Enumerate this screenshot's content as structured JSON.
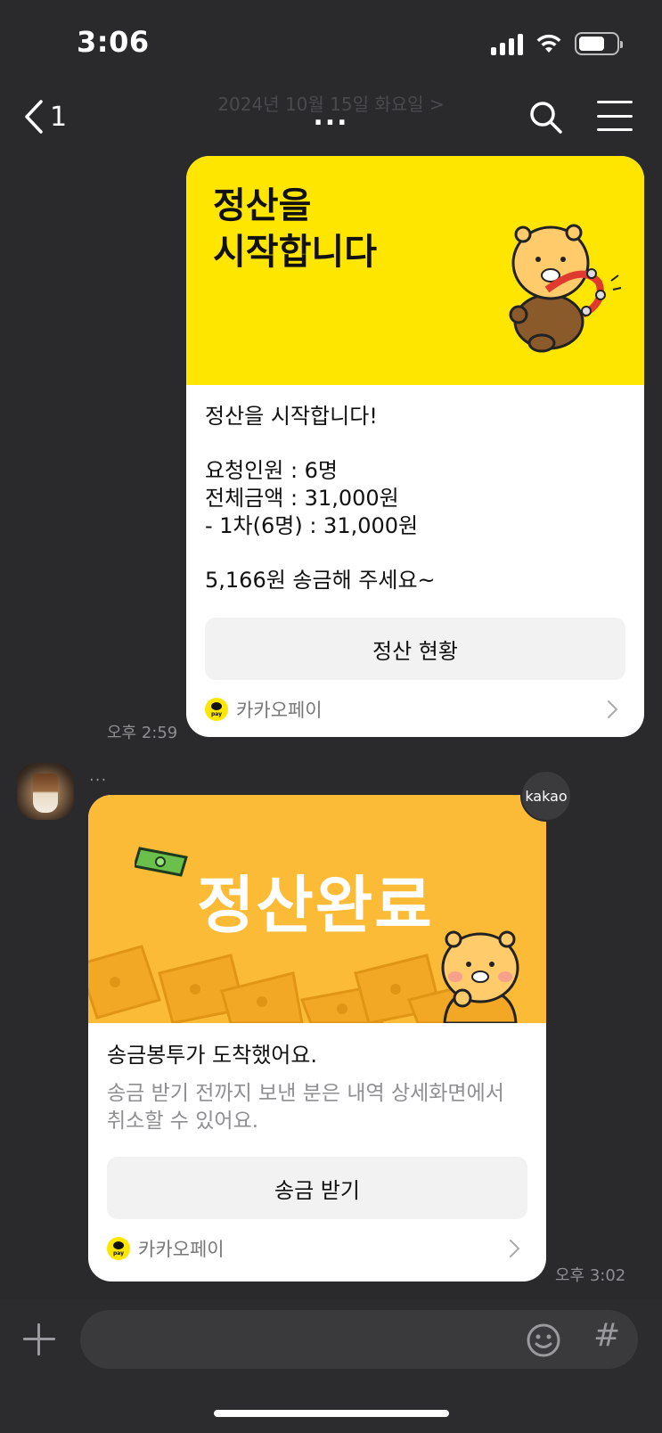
{
  "status_bar": {
    "time": "3:06",
    "signal_bars": 4,
    "wifi": true,
    "battery_level_percent": 70
  },
  "header": {
    "back_count": "1",
    "date_label": "2024년 10월 15일 화요일 >",
    "more_label": "...",
    "icons": [
      "chevron-left-icon",
      "search-icon",
      "menu-icon"
    ]
  },
  "messages": [
    {
      "banner_title_line1": "정산을",
      "banner_title_line2": "시작합니다",
      "banner_color": "#ffe600",
      "lines": [
        "정산을 시작합니다!",
        "요청인원 : 6명",
        "전체금액 : 31,000원",
        "- 1차(6명) : 31,000원",
        "5,166원 송금해 주세요~"
      ],
      "button_label": "정산 현황",
      "provider": "카카오페이",
      "time": "오후 2:59"
    },
    {
      "sender_name": "...",
      "badge": "kakao",
      "banner_title": "정산완료",
      "banner_color": "#fbbb36",
      "title": "송금봉투가 도착했어요.",
      "description": "송금 받기 전까지 보낸 분은 내역 상세화면에서 취소할 수 있어요.",
      "button_label": "송금 받기",
      "provider": "카카오페이",
      "time": "오후 3:02"
    }
  ],
  "input_bar": {
    "placeholder": "",
    "hash_label": "#",
    "icons": [
      "plus-icon",
      "emoji-icon",
      "hash-icon"
    ]
  },
  "colors": {
    "background": "#2a2a2d",
    "kakao_yellow": "#ffe600",
    "settlement_orange": "#fbbb36"
  }
}
